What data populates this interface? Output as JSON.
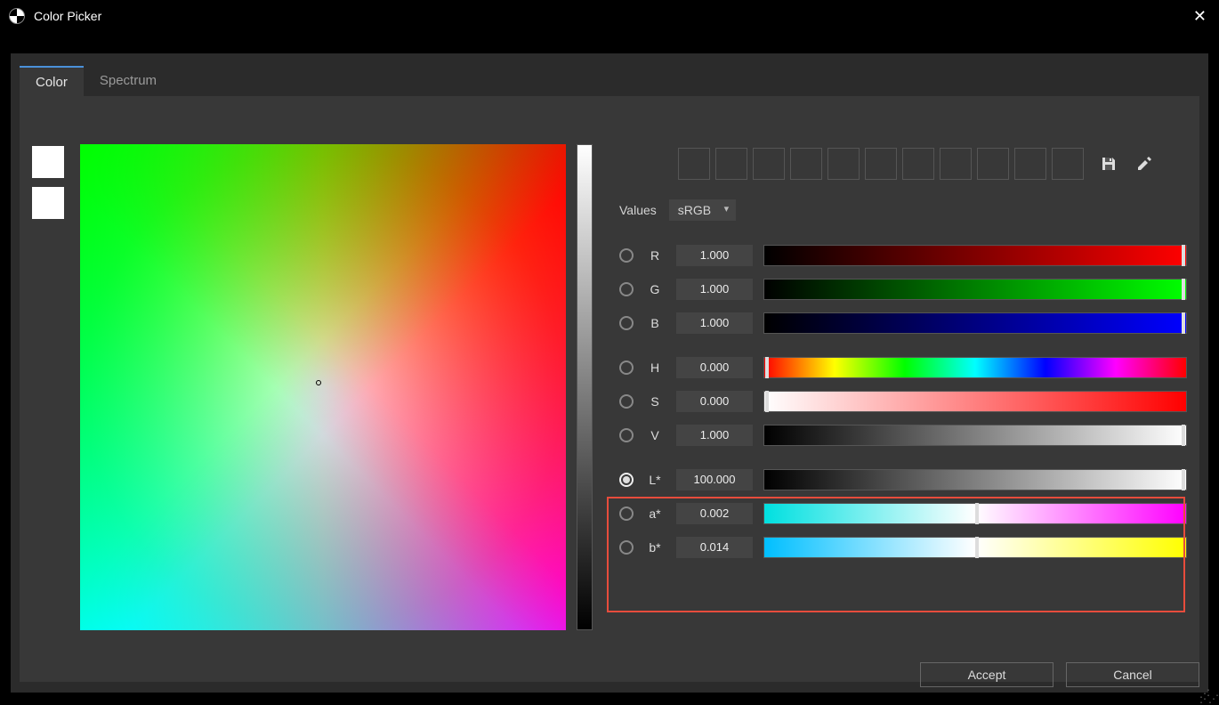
{
  "window": {
    "title": "Color Picker"
  },
  "tabs": {
    "color": "Color",
    "spectrum": "Spectrum",
    "active": "color"
  },
  "values": {
    "label": "Values",
    "selected": "sRGB"
  },
  "swatch_count": 11,
  "channels": {
    "r": {
      "label": "R",
      "value": "1.000"
    },
    "g": {
      "label": "G",
      "value": "1.000"
    },
    "b": {
      "label": "B",
      "value": "1.000"
    },
    "h": {
      "label": "H",
      "value": "0.000"
    },
    "s": {
      "label": "S",
      "value": "0.000"
    },
    "v": {
      "label": "V",
      "value": "1.000"
    },
    "l": {
      "label": "L*",
      "value": "100.000"
    },
    "a": {
      "label": "a*",
      "value": "0.002"
    },
    "bb": {
      "label": "b*",
      "value": "0.014"
    }
  },
  "selected_channel": "l",
  "buttons": {
    "accept": "Accept",
    "cancel": "Cancel"
  }
}
